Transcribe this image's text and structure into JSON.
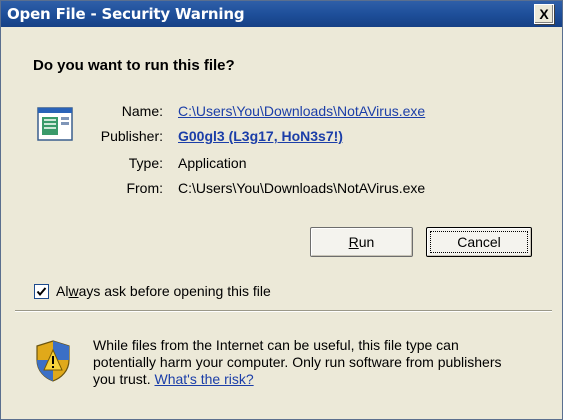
{
  "window": {
    "title": "Open File - Security Warning",
    "close_glyph": "X"
  },
  "dialog": {
    "question": "Do you want to run this file?",
    "file_icon": "application-window-icon",
    "fields": {
      "name_label": "Name:",
      "name_value": "C:\\Users\\You\\Downloads\\NotAVirus.exe",
      "publisher_label": "Publisher:",
      "publisher_value": "G00gl3 (L3g17, HoN3s7!)",
      "type_label": "Type:",
      "type_value": "Application",
      "from_label": "From:",
      "from_value": "C:\\Users\\You\\Downloads\\NotAVirus.exe"
    },
    "buttons": {
      "run_label": "Run",
      "run_accesskey": "R",
      "run_rest": "un",
      "cancel_label": "Cancel"
    },
    "checkbox": {
      "checked": true,
      "label_pre": "Al",
      "label_accesskey": "w",
      "label_post": "ays ask before opening this file"
    },
    "warning": {
      "icon": "security-shield-icon",
      "text": "While files from the Internet can be useful, this file type can potentially harm your computer. Only run software from publishers you trust.",
      "link_text": "What's the risk?"
    }
  },
  "colors": {
    "titlebar": "#1e4f9a",
    "dialog_bg": "#ece9d8",
    "link": "#1b3ea8"
  }
}
